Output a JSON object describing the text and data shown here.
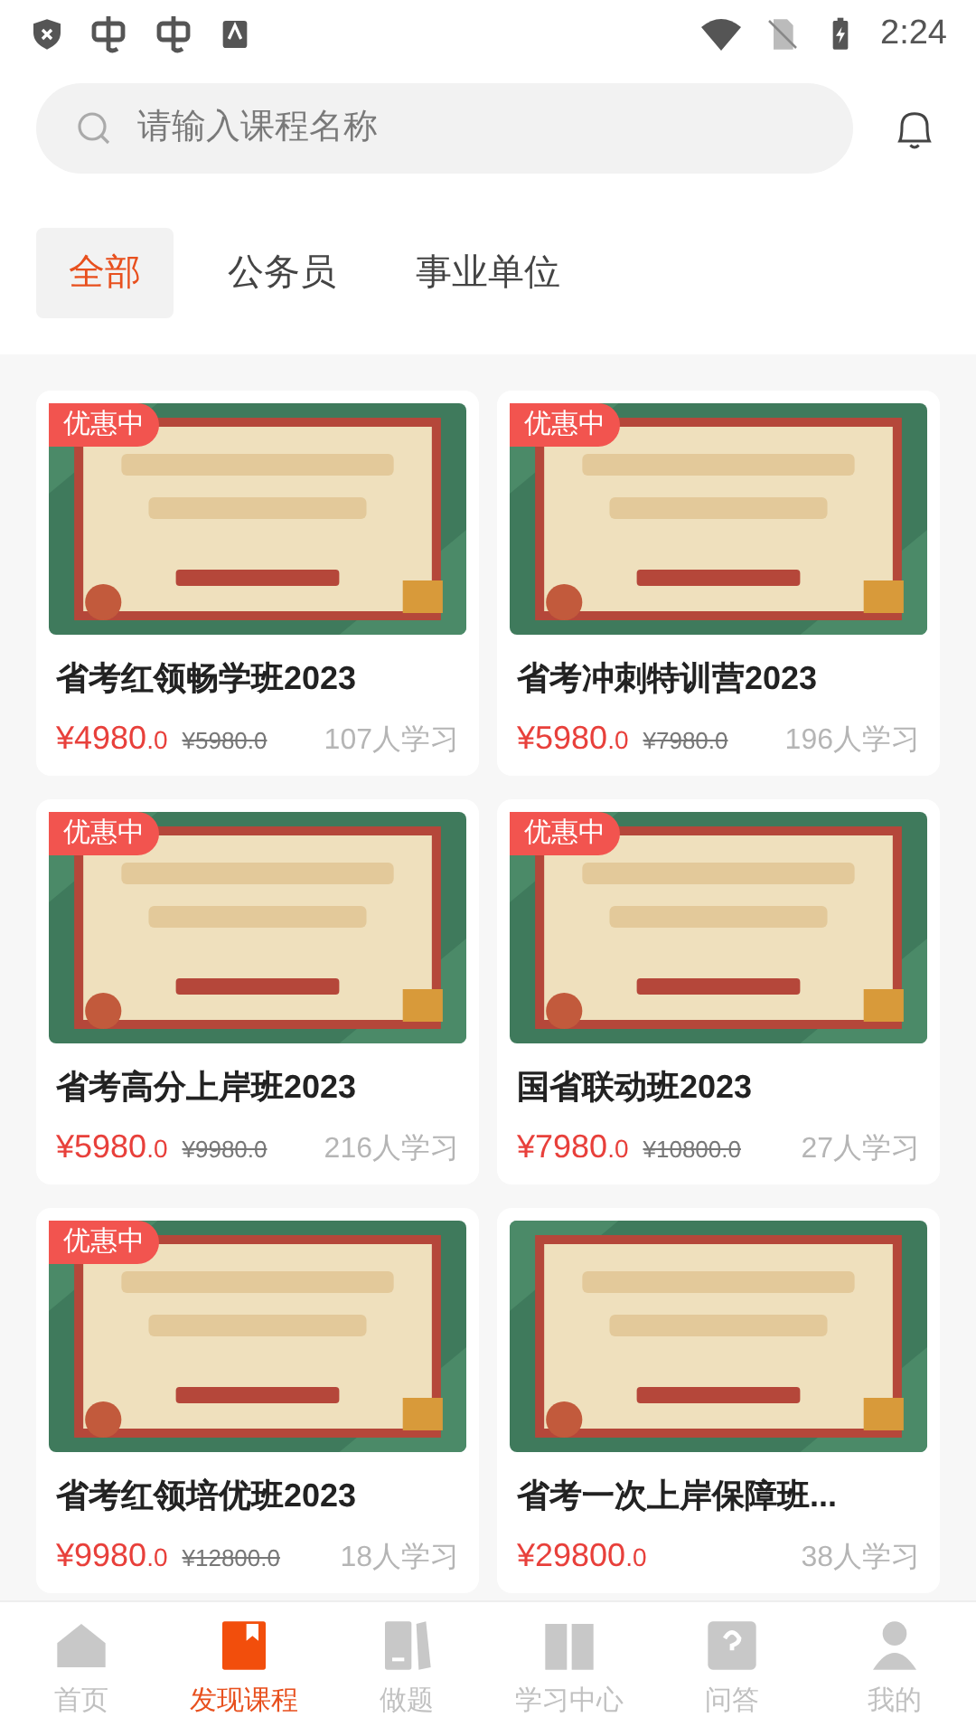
{
  "status_bar": {
    "time": "2:24"
  },
  "search": {
    "placeholder": "请输入课程名称"
  },
  "tabs": [
    {
      "label": "全部",
      "selected": true
    },
    {
      "label": "公务员",
      "selected": false
    },
    {
      "label": "事业单位",
      "selected": false
    }
  ],
  "courses": [
    {
      "badge": "优惠中",
      "title": "省考红领畅学班2023",
      "price": "¥4980",
      "price_decimal": ".0",
      "original_price": "¥5980.0",
      "learners": "107人学习"
    },
    {
      "badge": "优惠中",
      "title": "省考冲刺特训营2023",
      "price": "¥5980",
      "price_decimal": ".0",
      "original_price": "¥7980.0",
      "learners": "196人学习"
    },
    {
      "badge": "优惠中",
      "title": "省考高分上岸班2023",
      "price": "¥5980",
      "price_decimal": ".0",
      "original_price": "¥9980.0",
      "learners": "216人学习"
    },
    {
      "badge": "优惠中",
      "title": "国省联动班2023",
      "price": "¥7980",
      "price_decimal": ".0",
      "original_price": "¥10800.0",
      "learners": "27人学习"
    },
    {
      "badge": "优惠中",
      "title": "省考红领培优班2023",
      "price": "¥9980",
      "price_decimal": ".0",
      "original_price": "¥12800.0",
      "learners": "18人学习"
    },
    {
      "title": "省考一次上岸保障班...",
      "price": "¥29800",
      "price_decimal": ".0",
      "learners": "38人学习"
    }
  ],
  "bottom_nav": [
    {
      "label": "首页",
      "selected": false
    },
    {
      "label": "发现课程",
      "selected": true
    },
    {
      "label": "做题",
      "selected": false
    },
    {
      "label": "学习中心",
      "selected": false
    },
    {
      "label": "问答",
      "selected": false
    },
    {
      "label": "我的",
      "selected": false
    }
  ]
}
